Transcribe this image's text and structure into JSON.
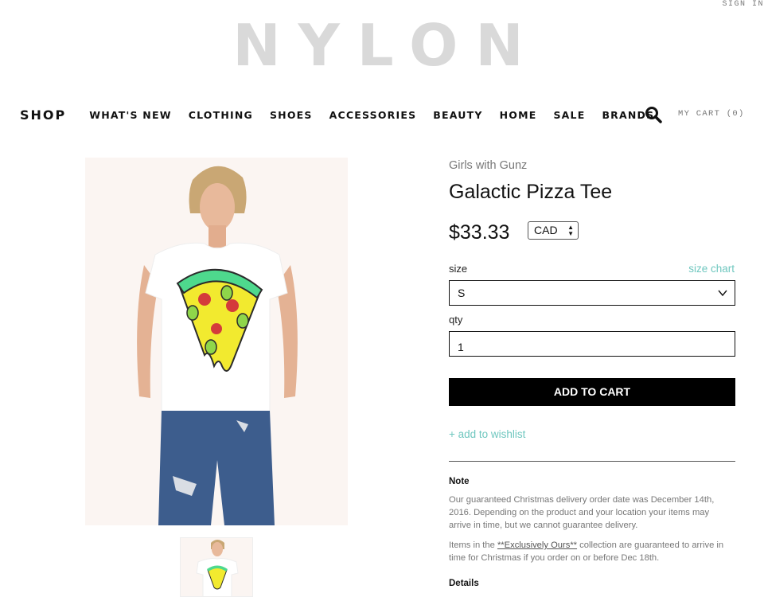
{
  "header": {
    "sign_in": "SIGN IN",
    "logo": "NYLON",
    "cart": "MY CART (0)"
  },
  "nav": {
    "shop": "SHOP",
    "items": [
      "WHAT'S NEW",
      "CLOTHING",
      "SHOES",
      "ACCESSORIES",
      "BEAUTY",
      "HOME",
      "SALE",
      "BRANDS"
    ]
  },
  "product": {
    "brand": "Girls with Gunz",
    "title": "Galactic Pizza Tee",
    "price": "$33.33",
    "currency": "CAD",
    "size_label": "size",
    "size_chart": "size chart",
    "size_value": "S",
    "qty_label": "qty",
    "qty_value": "1",
    "add_to_cart": "ADD TO CART",
    "wishlist": "+ add to wishlist"
  },
  "note": {
    "heading": "Note",
    "paragraph1": "Our guaranteed Christmas delivery order date was December 14th, 2016. Depending on the product and your location your items may arrive in time, but we cannot guarantee delivery.",
    "p2_before": "Items in the ",
    "p2_link": "**Exclusively Ours**",
    "p2_after": " collection are guaranteed to arrive in time for Christmas if you order on or before Dec 18th."
  },
  "details": {
    "heading": "Details"
  },
  "colors": {
    "accent": "#6fc7bf",
    "button_bg": "#000000",
    "logo": "#d9d9d9"
  },
  "icons": [
    "search-icon",
    "chevron-down-icon",
    "sort-arrows-icon"
  ]
}
